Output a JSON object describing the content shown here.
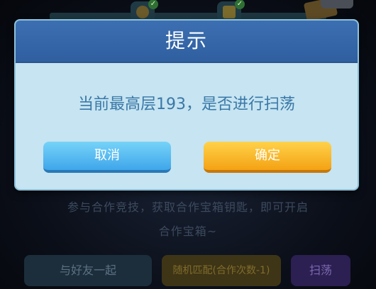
{
  "background": {
    "description_lines": [
      "参与合作竞技，获取合作宝箱钥匙，即可开启",
      "合作宝箱~"
    ],
    "buttons": {
      "play_with_friends": "与好友一起",
      "random_match": "随机匹配(合作次数-1)",
      "sweep": "扫荡"
    },
    "rewards": [
      {
        "icon": "coin-reward-icon",
        "claimed": true
      },
      {
        "icon": "card-reward-icon",
        "claimed": true
      },
      {
        "icon": "chest-icon",
        "claimed": false
      }
    ]
  },
  "dialog": {
    "title": "提示",
    "message": "当前最高层193，是否进行扫荡",
    "cancel_label": "取消",
    "confirm_label": "确定"
  },
  "colors": {
    "dialog_header": "#3c6fb2",
    "dialog_body": "#c6e4f1",
    "message_text": "#3a78a8",
    "cancel_button": "#4eb6f0",
    "confirm_button": "#f9b92a"
  }
}
